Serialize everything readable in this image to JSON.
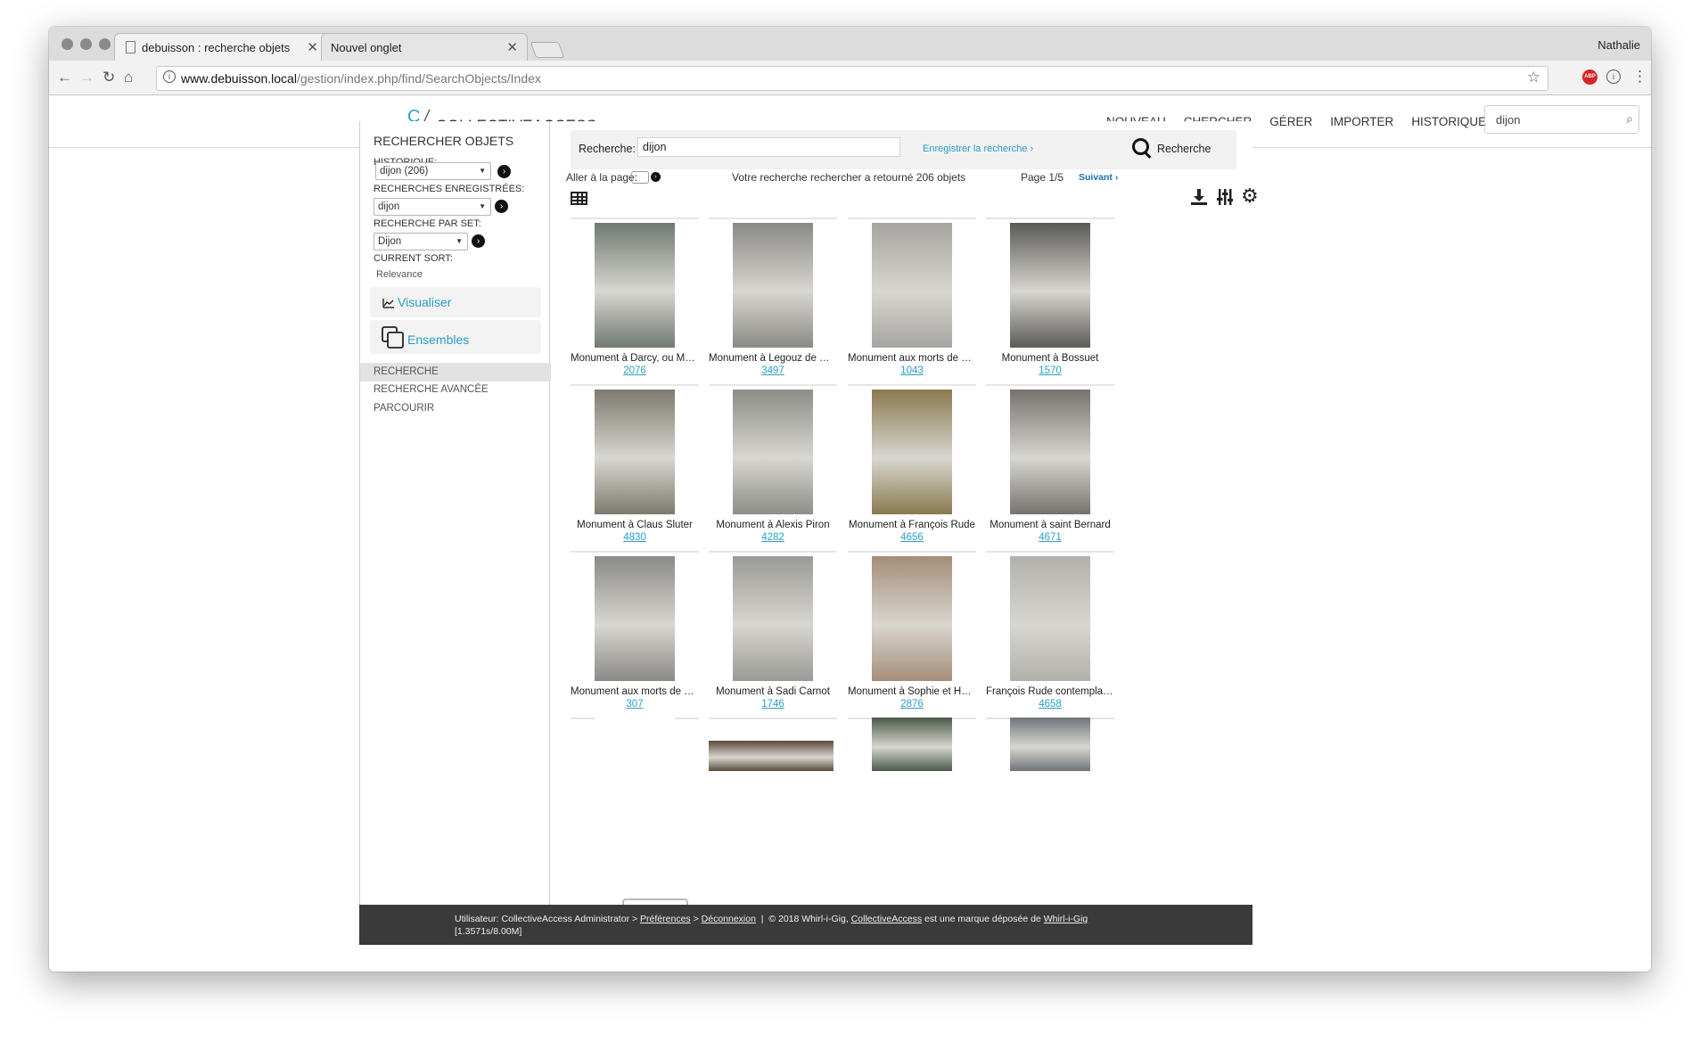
{
  "browser": {
    "tabs": [
      {
        "title": "debuisson : recherche objets",
        "active": true
      },
      {
        "title": "Nouvel onglet",
        "active": false
      }
    ],
    "profile": "Nathalie",
    "url_host": "www.debuisson.local",
    "url_path": "/gestion/index.php/find/SearchObjects/Index",
    "abp_label": "ABP"
  },
  "header": {
    "brand": "COLLECTIVEACCESS",
    "nav": [
      "NOUVEAU",
      "CHERCHER",
      "GÉRER",
      "IMPORTER",
      "HISTORIQUE"
    ],
    "search_value": "dijon"
  },
  "sidebar": {
    "title": "RECHERCHER OBJETS",
    "historique_label": "HISTORIQUE:",
    "historique_value": "dijon (206)",
    "saved_label": "RECHERCHES ENREGISTRÉES:",
    "saved_value": "dijon",
    "set_label": "RECHERCHE PAR SET:",
    "set_value": "Dijon",
    "sort_label": "CURRENT SORT:",
    "sort_value": "Relevance",
    "visualiser": "Visualiser",
    "ensembles": "Ensembles",
    "links": [
      "RECHERCHE",
      "RECHERCHE AVANCÉE",
      "PARCOURIR"
    ]
  },
  "search": {
    "label": "Recherche:",
    "value": "dijon",
    "save_link": "Enregistrer la recherche ›",
    "button": "Recherche"
  },
  "results": {
    "goto_label": "Aller à la page:",
    "summary": "Votre recherche rechercher a retourné 206 objets",
    "page": "Page 1/5",
    "next": "Suivant ›",
    "items": [
      {
        "title": "Monument à Darcy, ou Mon...",
        "id": "2076",
        "tone": "#6f7a72"
      },
      {
        "title": "Monument à Legouz de Ger...",
        "id": "3497",
        "tone": "#8a8a86"
      },
      {
        "title": "Monument aux morts de 18...",
        "id": "1043",
        "tone": "#a6a4a0"
      },
      {
        "title": "Monument à Bossuet",
        "id": "1570",
        "tone": "#5a5a57"
      },
      {
        "title": "Monument à Claus Sluter",
        "id": "4830",
        "tone": "#7e7a70"
      },
      {
        "title": "Monument à Alexis Piron",
        "id": "4282",
        "tone": "#8c8e88"
      },
      {
        "title": "Monument à François Rude",
        "id": "4656",
        "tone": "#8a7a4e"
      },
      {
        "title": "Monument à saint Bernard",
        "id": "4671",
        "tone": "#76736e"
      },
      {
        "title": "Monument aux morts de 14...",
        "id": "307",
        "tone": "#8a8a87"
      },
      {
        "title": "Monument à Sadi Carnot",
        "id": "1746",
        "tone": "#9a9a96"
      },
      {
        "title": "Monument à Sophie et Hen...",
        "id": "2876",
        "tone": "#a58e78"
      },
      {
        "title": "François Rude contemplan...",
        "id": "4658",
        "tone": "#b2b0ab"
      },
      {
        "title": "",
        "id": "",
        "tone": "#ffffff"
      },
      {
        "title": "",
        "id": "",
        "tone": "#5a4a3a"
      },
      {
        "title": "",
        "id": "",
        "tone": "#4a5a48"
      },
      {
        "title": "",
        "id": "",
        "tone": "#6f747a"
      }
    ]
  },
  "footer": {
    "user_label": "Utilisateur: CollectiveAccess Administrator",
    "prefs": "Préférences",
    "logout": "Déconnexion",
    "copyright_pre": "© 2018 Whirl-i-Gig,",
    "ca_link": "CollectiveAccess",
    "copyright_mid": "est une marque déposée de",
    "wig_link": "Whirl-i-Gig",
    "perf": "[1.3571s/8.00M]"
  },
  "colors": {
    "accent": "#2a9ec7",
    "footer_bg": "#3a3a3a"
  }
}
